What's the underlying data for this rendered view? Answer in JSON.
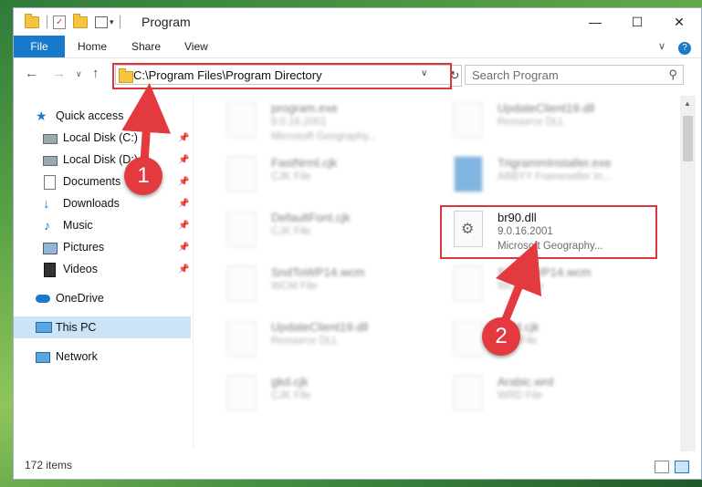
{
  "window": {
    "title": "Program",
    "minimize": "—",
    "maximize": "☐",
    "close": "✕",
    "help": "?",
    "expand": "∨"
  },
  "ribbon": {
    "tabs": [
      "File",
      "Home",
      "Share",
      "View"
    ]
  },
  "address_bar": {
    "path": "C:\\Program Files\\Program Directory",
    "back": "←",
    "forward": "→",
    "recent": "∨",
    "up": "↑",
    "refresh": "↻",
    "dropdown": "∨"
  },
  "search": {
    "placeholder": "Search Program",
    "icon": "⚲"
  },
  "sidebar": {
    "items": [
      {
        "label": "Quick access",
        "icon": "star-icon",
        "pinned": false
      },
      {
        "label": "Local Disk (C:)",
        "icon": "drive-icon",
        "pinned": true
      },
      {
        "label": "Local Disk (D:)",
        "icon": "drive-icon",
        "pinned": true
      },
      {
        "label": "Documents",
        "icon": "documents-icon",
        "pinned": true
      },
      {
        "label": "Downloads",
        "icon": "downloads-icon",
        "pinned": true
      },
      {
        "label": "Music",
        "icon": "music-icon",
        "pinned": true
      },
      {
        "label": "Pictures",
        "icon": "pictures-icon",
        "pinned": true
      },
      {
        "label": "Videos",
        "icon": "videos-icon",
        "pinned": true
      },
      {
        "label": "OneDrive",
        "icon": "cloud-icon",
        "pinned": false
      },
      {
        "label": "This PC",
        "icon": "computer-icon",
        "pinned": false,
        "selected": true
      },
      {
        "label": "Network",
        "icon": "network-icon",
        "pinned": false
      }
    ],
    "pin_glyph": "📌"
  },
  "files": [
    {
      "name": "program.exe",
      "line1": "9.0.16.2001",
      "line2": "Microsoft Geography...",
      "blurred": true
    },
    {
      "name": "UpdateClient19.dll",
      "line1": "Resource DLL",
      "line2": "",
      "blurred": true
    },
    {
      "name": "FastNrml.cjk",
      "line1": "CJK File",
      "line2": "",
      "blurred": true
    },
    {
      "name": "TrigrammInstaller.exe",
      "line1": "ABBYY Frameseller In...",
      "line2": "",
      "blurred": true
    },
    {
      "name": "DefaultFont.cjk",
      "line1": "CJK File",
      "line2": "",
      "blurred": true
    },
    {
      "name": "br90.dll",
      "line1": "9.0.16.2001",
      "line2": "Microsoft Geography...",
      "blurred": false
    },
    {
      "name": "SndToWP14.wcm",
      "line1": "WCM File",
      "line2": "",
      "blurred": true
    },
    {
      "name": "SndToWP14.wcm",
      "line1": "WCM File",
      "line2": "",
      "blurred": true
    },
    {
      "name": "UpdateClient19.dll",
      "line1": "Resource DLL",
      "line2": "",
      "blurred": true
    },
    {
      "name": "Bold.cjk",
      "line1": "CJK File",
      "line2": "",
      "blurred": true
    },
    {
      "name": "gkd.cjk",
      "line1": "CJK File",
      "line2": "",
      "blurred": true
    },
    {
      "name": "Arabic.wrd",
      "line1": "WRD File",
      "line2": "",
      "blurred": true
    }
  ],
  "status": {
    "item_count": "172 items"
  },
  "annotations": {
    "badge1": "1",
    "badge2": "2",
    "accent": "#d9363e"
  }
}
